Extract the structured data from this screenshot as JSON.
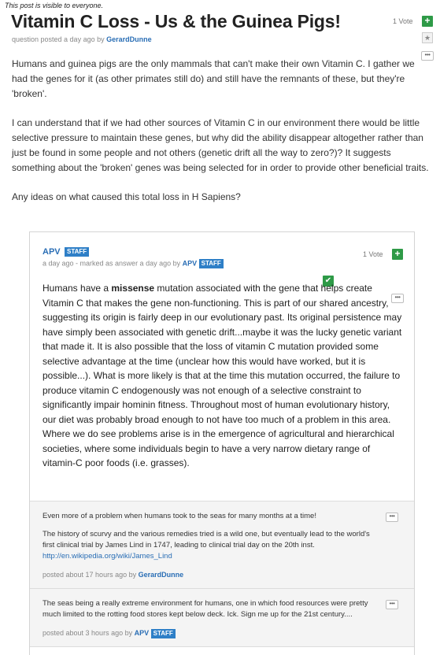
{
  "visibility_note": "This post is visible to everyone.",
  "question": {
    "title": "Vitamin C Loss - Us & the Guinea Pigs!",
    "meta_prefix": "question posted a day ago by ",
    "author": "GerardDunne",
    "votes": "1 Vote",
    "vote_button": "+",
    "star_icon": "★",
    "more_icon": "•••",
    "paragraphs": [
      "Humans and guinea pigs are the only mammals that can't make their own Vitamin C. I gather we had the genes for it (as other primates still do) and still have the remnants of these, but they're 'broken'.",
      "I can understand that if we had other sources of Vitamin C in our environment there would be little selective pressure to maintain these genes, but why did the ability disappear altogether rather than just be found in some people and not others (genetic drift all the way to zero?)? It suggests something about the 'broken' genes was being selected for in order to provide other beneficial traits.",
      "Any ideas on what caused this total loss in H Sapiens?"
    ]
  },
  "answer": {
    "author": "APV",
    "staff_label": "STAFF",
    "meta_prefix": "a day ago - marked as answer a day ago by ",
    "meta_author": "APV",
    "votes": "1 Vote",
    "vote_button": "+",
    "accepted_icon": "✔",
    "more_icon": "•••",
    "body_before": "Humans have a ",
    "body_bold": "missense",
    "body_after": " mutation associated with the gene that helps create Vitamin C that makes the gene non-functioning. This is part of our shared ancestry, suggesting its origin is fairly deep in our evolutionary past. Its original persistence may have simply been associated with genetic drift...maybe it was the lucky genetic variant that made it. It is also possible that the loss of vitamin C mutation provided some selective advantage at the time (unclear how this would have worked, but it is possible...). What is more likely is that at the time this mutation occurred, the failure to produce vitamin C endogenously was not enough of a selective constraint to significantly impair hominin fitness. Throughout most of human evolutionary history, our diet was probably broad enough to not have too much of a problem in this area. Where we do see problems arise is in the emergence of agricultural and hierarchical societies, where some individuals begin to have a very narrow dietary range of vitamin-C poor foods (i.e. grasses)."
  },
  "comments": [
    {
      "p1": "Even more of a problem when humans took to the seas for many months at a time!",
      "p2": "The history of scurvy and the various remedies tried is a wild one, but eventually lead to the world's first clinical trial by James Lind in 1747, leading to clinical trial day on the 20th inst. ",
      "link": "http://en.wikipedia.org/wiki/James_Lind",
      "meta_prefix": "posted about 17 hours ago by ",
      "author": "GerardDunne",
      "staff": "",
      "more_icon": "•••"
    },
    {
      "p1": "The seas being a really extreme environment for humans, one in which food resources were pretty much limited to the rotting food stores kept below deck. Ick. Sign me up for the 21st century....",
      "meta_prefix": "posted about 3 hours ago by ",
      "author": "APV",
      "staff": "STAFF",
      "more_icon": "•••"
    }
  ]
}
